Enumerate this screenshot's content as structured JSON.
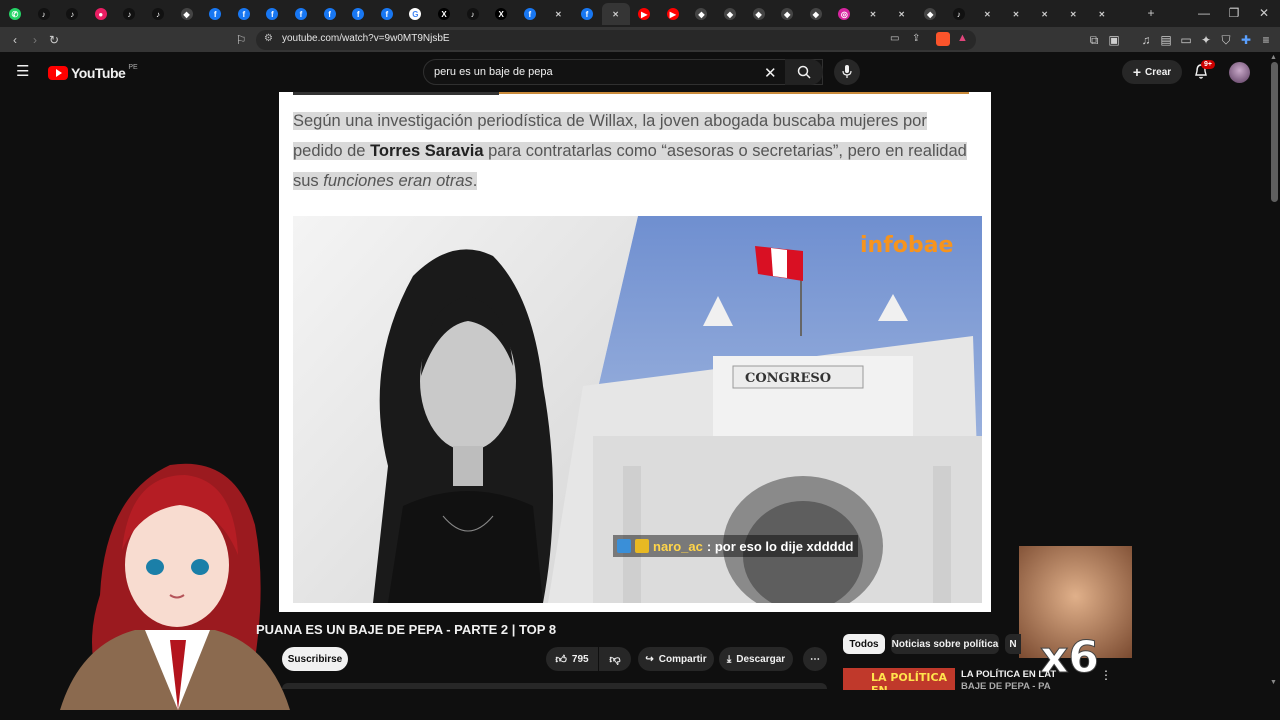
{
  "browser": {
    "url": "youtube.com/watch?v=9w0MT9NjsbE",
    "tabs": [
      "whatsapp",
      "tiktok",
      "tiktok",
      "youtube-red",
      "tiktok",
      "tiktok",
      "app",
      "facebook",
      "facebook",
      "facebook",
      "facebook",
      "facebook",
      "facebook",
      "facebook",
      "google",
      "x",
      "tiktok",
      "x",
      "facebook",
      "muted",
      "facebook",
      "close-active",
      "youtube",
      "youtube",
      "app",
      "app",
      "app",
      "app",
      "app",
      "instagram",
      "muted",
      "muted",
      "app",
      "tiktok",
      "muted",
      "muted",
      "muted",
      "muted",
      "muted"
    ],
    "new_tab": "+"
  },
  "youtube": {
    "logo_text": "YouTube",
    "region": "PE",
    "search_value": "peru es un baje de pepa",
    "create_label": "Crear",
    "notif_count": "9+"
  },
  "article": {
    "p1": "Según una investigación periodística de Willax, la joven abogada buscaba mujeres por pedido de ",
    "bold": "Torres Saravia",
    "p2": " para contratarlas como “asesoras o secretarias”, pero en realidad sus ",
    "italic": "funciones eran otras",
    "p3": ".",
    "image_brand": "infobae",
    "building_sign": "CONGRESO"
  },
  "chat": {
    "user": "naro_ac",
    "message": ": por eso lo dije xddddd"
  },
  "video": {
    "title": "PUANA ES UN BAJE DE PEPA - PARTE 2 | TOP 8",
    "subscribe": "Suscribirse",
    "likes": "795",
    "share": "Compartir",
    "download": "Descargar"
  },
  "sidebar": {
    "chips": [
      "Todos",
      "Noticias sobre política",
      "N"
    ],
    "rec_thumb_text": "LA POLÍTICA EN",
    "rec_title_1": "LA POLÍTICA EN LAT",
    "rec_title_2": "BAJE DE PEPA - PA"
  },
  "overlay": {
    "multiplier": "x6"
  },
  "colors": {
    "youtube_red": "#ff0000",
    "infobae_orange": "#f7941d",
    "bg": "#0f0f0f"
  }
}
